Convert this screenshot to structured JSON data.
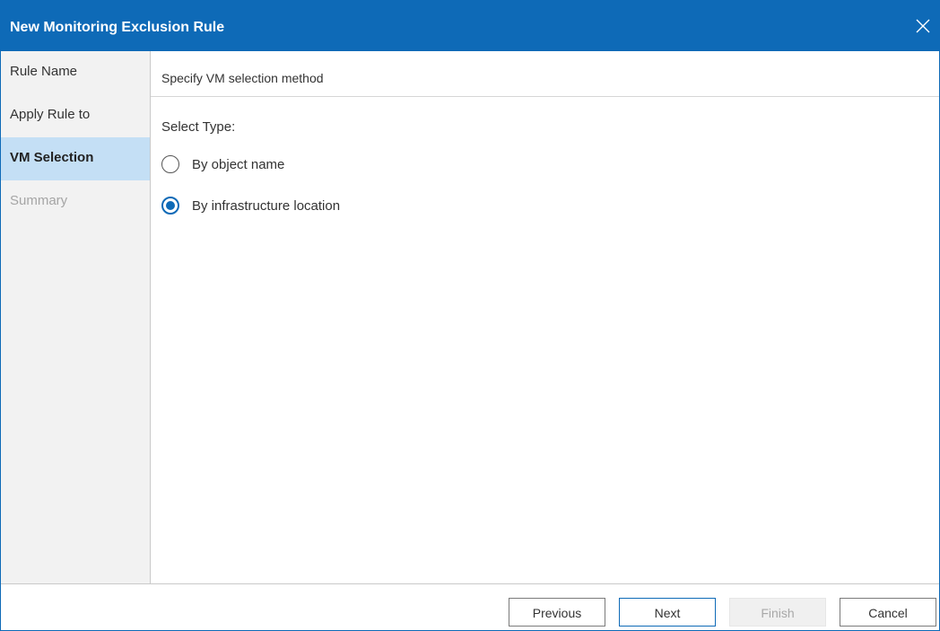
{
  "window": {
    "title": "New Monitoring Exclusion Rule",
    "close_icon": "close-icon"
  },
  "sidebar": {
    "items": [
      {
        "label": "Rule Name",
        "state": "normal"
      },
      {
        "label": "Apply Rule to",
        "state": "normal"
      },
      {
        "label": "VM Selection",
        "state": "active"
      },
      {
        "label": "Summary",
        "state": "disabled"
      }
    ]
  },
  "main": {
    "header": "Specify VM selection method",
    "select_type_label": "Select Type:",
    "options": [
      {
        "label": "By object name",
        "checked": false
      },
      {
        "label": "By infrastructure location",
        "checked": true
      }
    ]
  },
  "buttons": {
    "previous": "Previous",
    "next": "Next",
    "finish": "Finish",
    "cancel": "Cancel"
  },
  "colors": {
    "accent": "#0e6ab7",
    "active_nav_bg": "#c4dff5",
    "sidebar_bg": "#f2f2f2"
  }
}
